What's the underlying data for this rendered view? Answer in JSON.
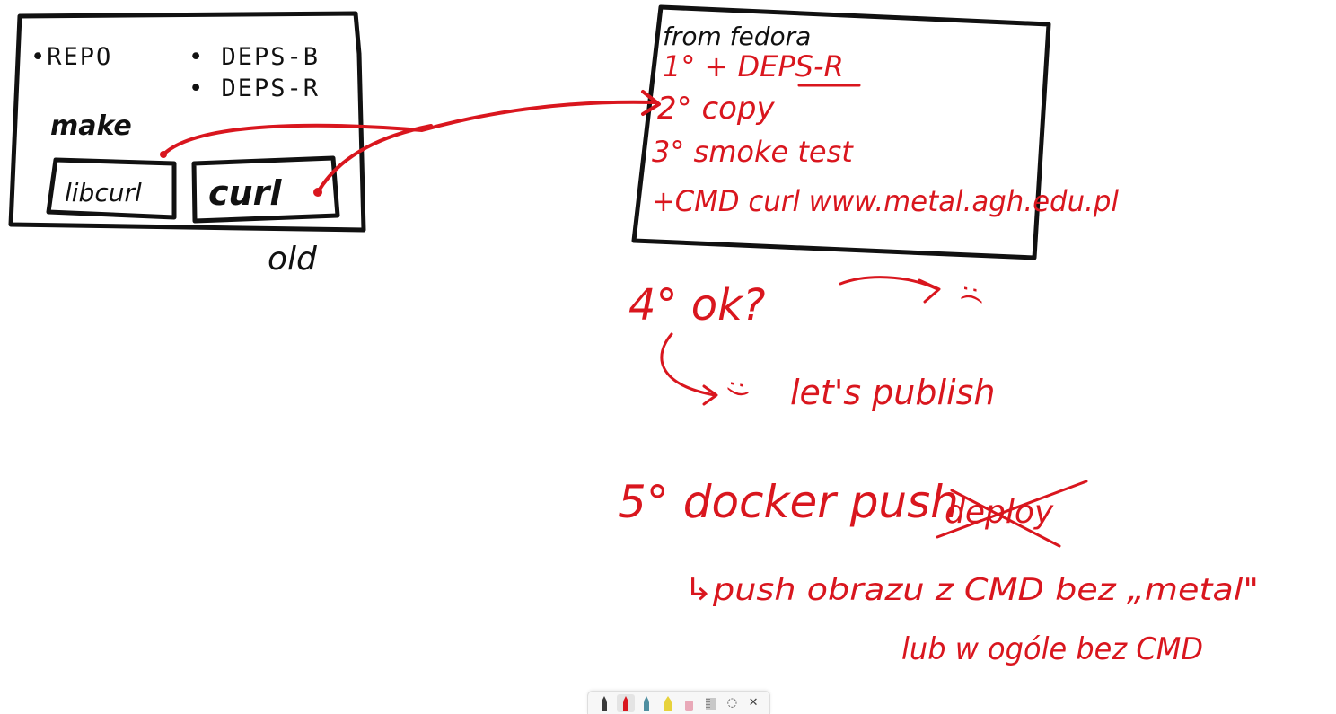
{
  "canvas": {
    "ink_colors": {
      "black": "#111111",
      "red": "#d9161e"
    }
  },
  "left_diagram": {
    "repo": "•REPO",
    "deps_b": "• DEPS-B",
    "deps_r": "• DEPS-R",
    "make": "make",
    "libcurl": "libcurl",
    "curl": "curl",
    "old": "old"
  },
  "dockerfile_box": {
    "from_line": "from fedora",
    "step1": "1° + DEPS-R",
    "step2": "2° copy",
    "step3": "3° smoke test",
    "cmd": "+CMD curl www.metal.agh.edu.pl"
  },
  "notes": {
    "step4": "4° ok?",
    "sad_face": ":(",
    "happy_face": ":)",
    "lets_publish": "let's publish",
    "step5": "5° docker push",
    "crossed_out": "deploy",
    "push_note": "↳push obrazu z CMD bez „metal\"",
    "or_note": "lub w ogóle bez CMD"
  },
  "toolbar": {
    "tools": [
      {
        "name": "ballpoint-pen-black",
        "color": "#3a3a3a"
      },
      {
        "name": "ballpoint-pen-red",
        "color": "#d9161e",
        "active": true
      },
      {
        "name": "ballpoint-pen-teal",
        "color": "#4f8ea0"
      },
      {
        "name": "highlighter-yellow",
        "color": "#e7d23b"
      },
      {
        "name": "eraser",
        "color": "#e9a9b8"
      },
      {
        "name": "ruler",
        "color": "#c8c8c8"
      }
    ],
    "lasso_icon": "lasso-select-icon",
    "close_icon": "close-icon"
  }
}
